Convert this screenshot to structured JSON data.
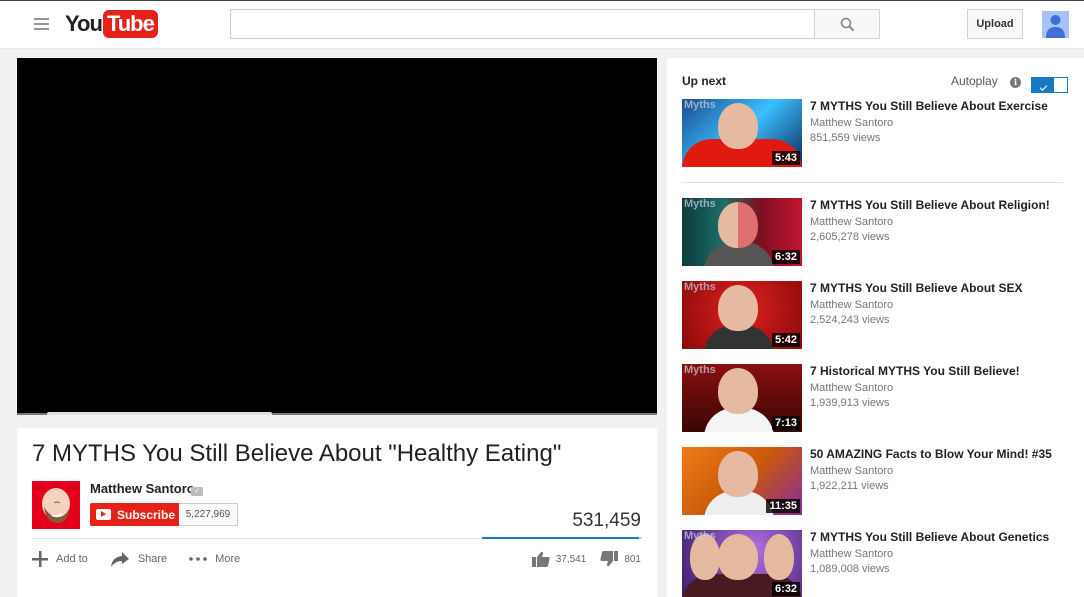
{
  "masthead": {
    "logo_you": "You",
    "logo_tube": "Tube",
    "search_value": "",
    "search_placeholder": "",
    "upload_label": "Upload",
    "icons": {
      "menu": "hamburger-menu-icon",
      "search": "magnifier-icon",
      "avatar": "user-silhouette-icon"
    }
  },
  "player": {
    "state": "black-empty"
  },
  "video": {
    "title": "7 MYTHS You Still Believe About \"Healthy Eating\"",
    "channel": "Matthew Santoro",
    "verified": "✓",
    "subscribe_label": "Subscribe",
    "subscriber_count": "5,227,969",
    "views": "531,459",
    "like_ratio": 0.979,
    "likes": "37,541",
    "dislikes": "801",
    "actions": [
      {
        "label": "Add to",
        "icon": "plus-icon"
      },
      {
        "label": "Share",
        "icon": "share-arrow-icon"
      },
      {
        "label": "More",
        "icon": "ellipsis-icon"
      }
    ]
  },
  "sidebar": {
    "up_next": "Up next",
    "autoplay_label": "Autoplay",
    "autoplay_on": true,
    "info_glyph": "i",
    "colors": {
      "accent": "#167ac6",
      "brand_red": "#e62117"
    },
    "videos": [
      {
        "title": "7 MYTHS You Still Believe About Exercise",
        "channel": "Matthew Santoro",
        "views": "851,559 views",
        "duration": "5:43",
        "brand": "Myths"
      },
      {
        "title": "7 MYTHS You Still Believe About Religion!",
        "channel": "Matthew Santoro",
        "views": "2,605,278 views",
        "duration": "6:32",
        "brand": "Myths"
      },
      {
        "title": "7 MYTHS You Still Believe About SEX",
        "channel": "Matthew Santoro",
        "views": "2,524,243 views",
        "duration": "5:42",
        "brand": "Myths"
      },
      {
        "title": "7 Historical MYTHS You Still Believe!",
        "channel": "Matthew Santoro",
        "views": "1,939,913 views",
        "duration": "7:13",
        "brand": "Myths"
      },
      {
        "title": "50 AMAZING Facts to Blow Your Mind! #35",
        "channel": "Matthew Santoro",
        "views": "1,922,211 views",
        "duration": "11:35",
        "brand": ""
      },
      {
        "title": "7 MYTHS You Still Believe About Genetics",
        "channel": "Matthew Santoro",
        "views": "1,089,008 views",
        "duration": "6:32",
        "brand": "Myths"
      }
    ]
  }
}
